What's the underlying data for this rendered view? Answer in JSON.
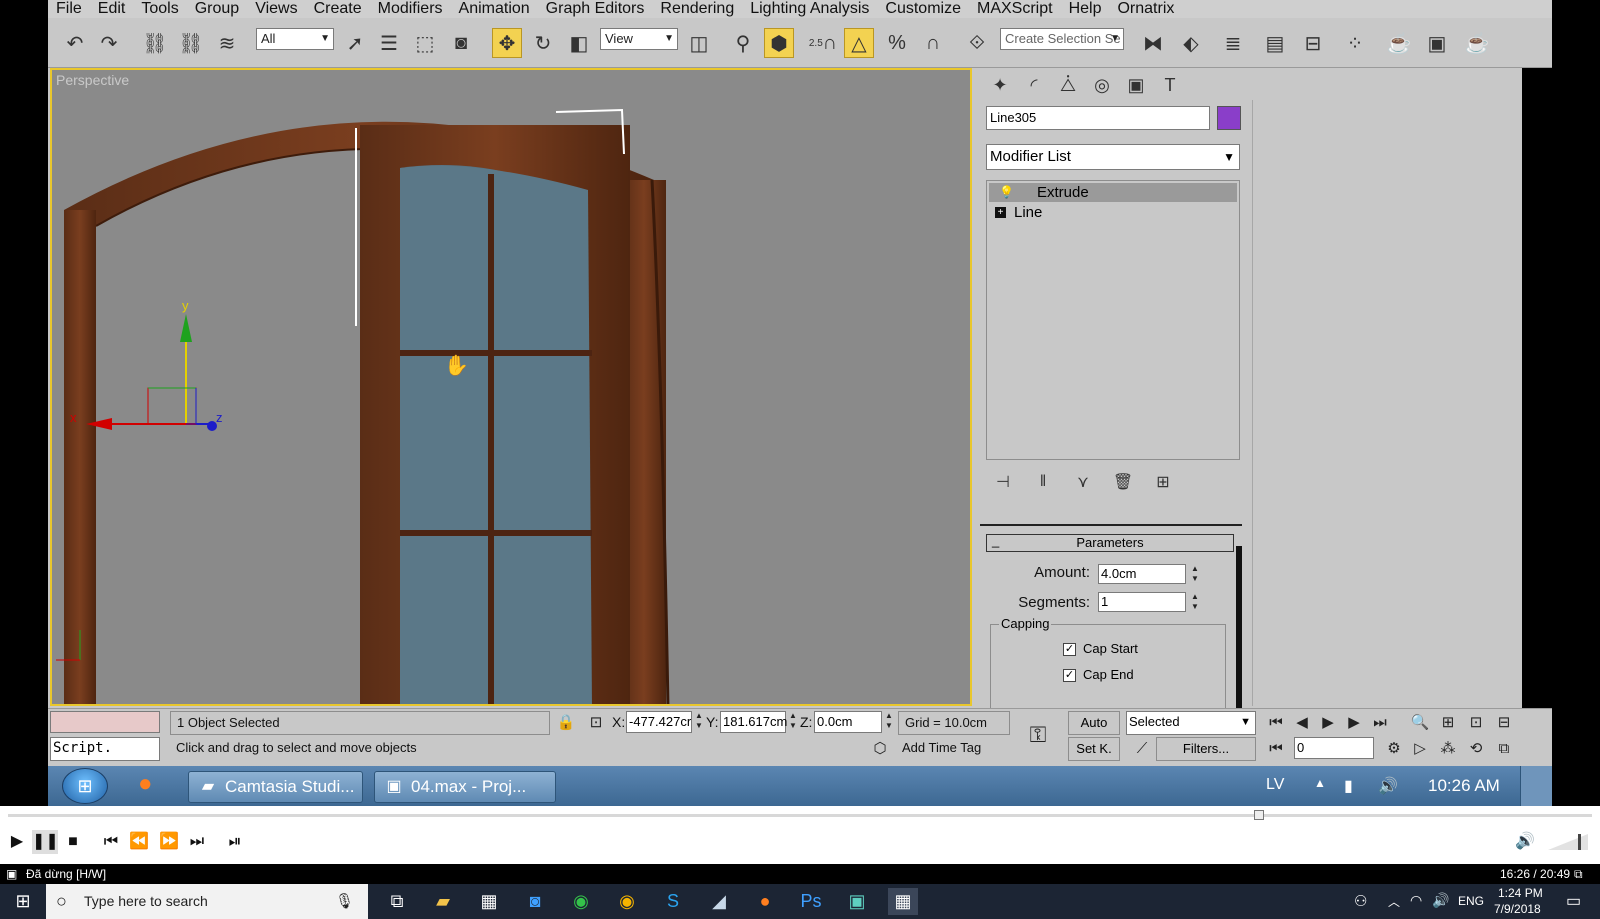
{
  "menu": [
    "File",
    "Edit",
    "Tools",
    "Group",
    "Views",
    "Create",
    "Modifiers",
    "Animation",
    "Graph Editors",
    "Rendering",
    "Lighting Analysis",
    "Customize",
    "MAXScript",
    "Help",
    "Ornatrix"
  ],
  "toolbar": {
    "selection_filter": "All",
    "ref_coord": "View",
    "named_selection_placeholder": "Create Selection Se",
    "snap_label": "2.5"
  },
  "viewport": {
    "label": "Perspective",
    "gizmo_axes": {
      "x": "x",
      "y": "y",
      "z": "z"
    }
  },
  "command_panel": {
    "object_name": "Line305",
    "object_color": "#8a3ec9",
    "modifier_list": "Modifier List",
    "stack": [
      {
        "label": "Extrude",
        "selected": true
      },
      {
        "label": "Line",
        "selected": false,
        "expand": "+"
      }
    ],
    "parameters": {
      "title": "Parameters",
      "collapse_symbol": "_",
      "amount_label": "Amount:",
      "amount_value": "4.0cm",
      "segments_label": "Segments:",
      "segments_value": "1",
      "capping_title": "Capping",
      "cap_start_label": "Cap Start",
      "cap_start_checked": "✓",
      "cap_end_label": "Cap End",
      "cap_end_checked": "✓"
    }
  },
  "status": {
    "maxscript_label": "Script.",
    "selection_count": "1 Object Selected",
    "prompt": "Click and drag to select and move objects",
    "x_label": "X:",
    "x_value": "-477.427cr",
    "y_label": "Y:",
    "y_value": "181.617cm",
    "z_label": "Z:",
    "z_value": "0.0cm",
    "grid": "Grid = 10.0cm",
    "add_time_tag": "Add Time Tag",
    "auto_key": "Auto",
    "set_key": "Set K.",
    "key_filter_select": "Selected",
    "filters": "Filters...",
    "frame_value": "0"
  },
  "inner_taskbar": {
    "apps": [
      {
        "label": "Camtasia Studi..."
      },
      {
        "label": "04.max     - Proj..."
      }
    ],
    "lang": "LV",
    "clock": "10:26 AM"
  },
  "player": {
    "status_text": "Đã dừng [H/W]",
    "time": "16:26 / 20:49"
  },
  "win_taskbar": {
    "search_placeholder": "Type here to search",
    "lang": "ENG",
    "time": "1:24 PM",
    "date": "7/9/2018"
  }
}
